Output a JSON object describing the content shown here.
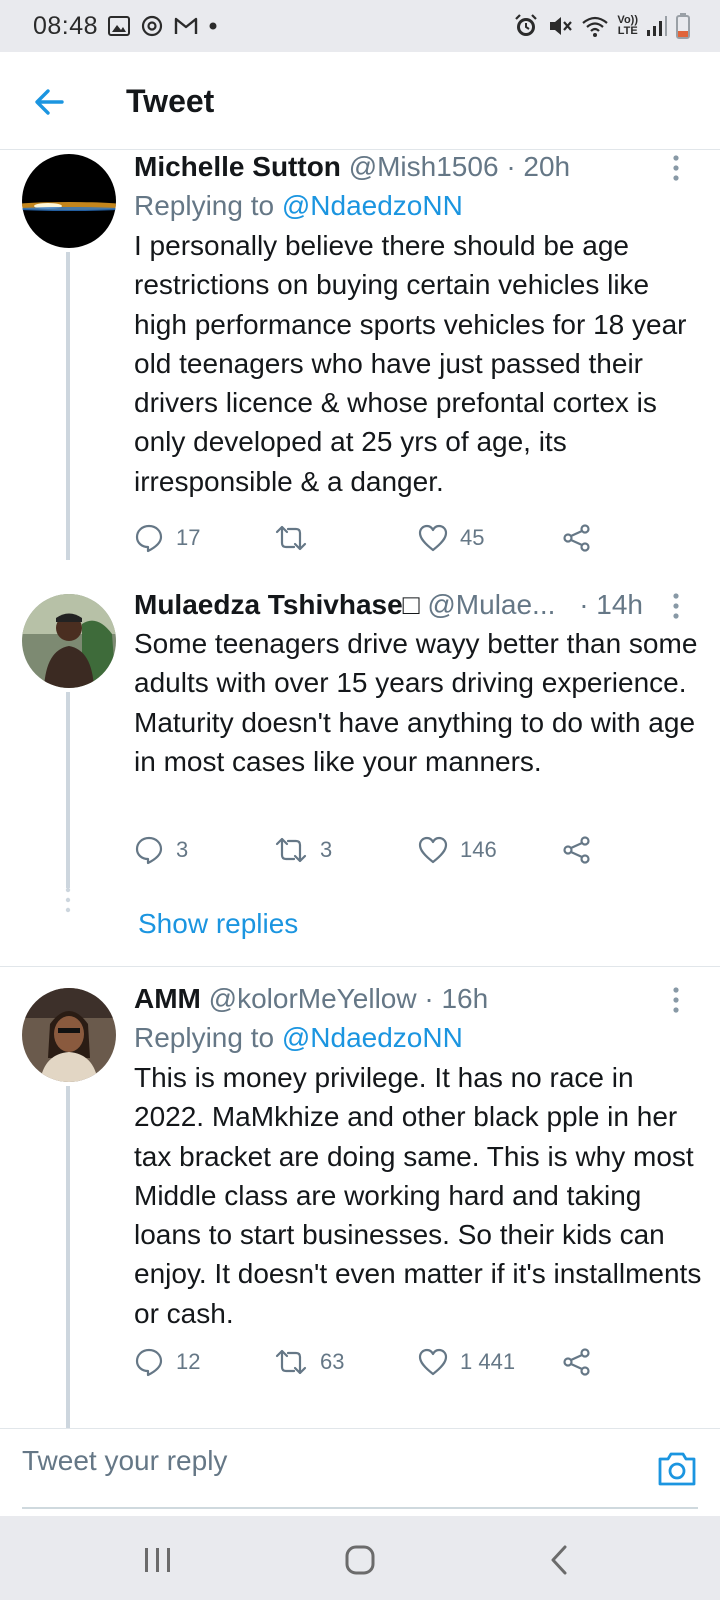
{
  "status_bar": {
    "time": "08:48",
    "left_icons": [
      "gallery-icon",
      "sync-icon",
      "gmail-icon",
      "notification-dot-icon"
    ],
    "right_icons": [
      "alarm-icon",
      "mute-icon",
      "wifi-icon",
      "volte-icon",
      "signal-icon",
      "battery-icon"
    ],
    "volte_top": "Vo))",
    "volte_bottom": "LTE"
  },
  "header": {
    "title": "Tweet",
    "back_icon": "back-arrow-icon"
  },
  "tweets": [
    {
      "name": "Michelle Sutton",
      "handle": "@Mish1506",
      "time": "· 20h",
      "replying_prefix": "Replying to ",
      "replying_to": "@NdaedzoNN",
      "text": "I personally believe there should be age restrictions on buying certain vehicles like high performance sports vehicles for 18 year old teenagers who have just passed their drivers licence & whose prefontal cortex is only developed at 25 yrs of age, its irresponsible & a danger.",
      "replies": "17",
      "retweets": "",
      "likes": "45"
    },
    {
      "name": "Mulaedza Tshivhase□",
      "handle": "@Mulae...",
      "time": "· 14h",
      "text": "Some teenagers drive wayy better than some adults with over 15 years driving experience. Maturity doesn't have anything to do with age in most cases like your manners.",
      "replies": "3",
      "retweets": "3",
      "likes": "146"
    },
    {
      "name": "AMM",
      "handle": "@kolorMeYellow",
      "time": "· 16h",
      "replying_prefix": "Replying to ",
      "replying_to": "@NdaedzoNN",
      "text": "This is money privilege. It has no race in 2022. MaMkhize and other black pple in her tax bracket are doing same. This is why most Middle class are working hard and taking loans to start businesses. So their kids can enjoy. It doesn't even matter if it's installments or cash.",
      "replies": "12",
      "retweets": "63",
      "likes": "1 441"
    }
  ],
  "show_replies": "Show replies",
  "reply_bar": {
    "placeholder": "Tweet your reply"
  },
  "nav_bar": {
    "buttons": [
      "recents-icon",
      "home-icon",
      "back-icon"
    ]
  },
  "colors": {
    "accent": "#1b95e0",
    "muted": "#657786",
    "text": "#14171a",
    "thread_line": "#cdd6de"
  }
}
